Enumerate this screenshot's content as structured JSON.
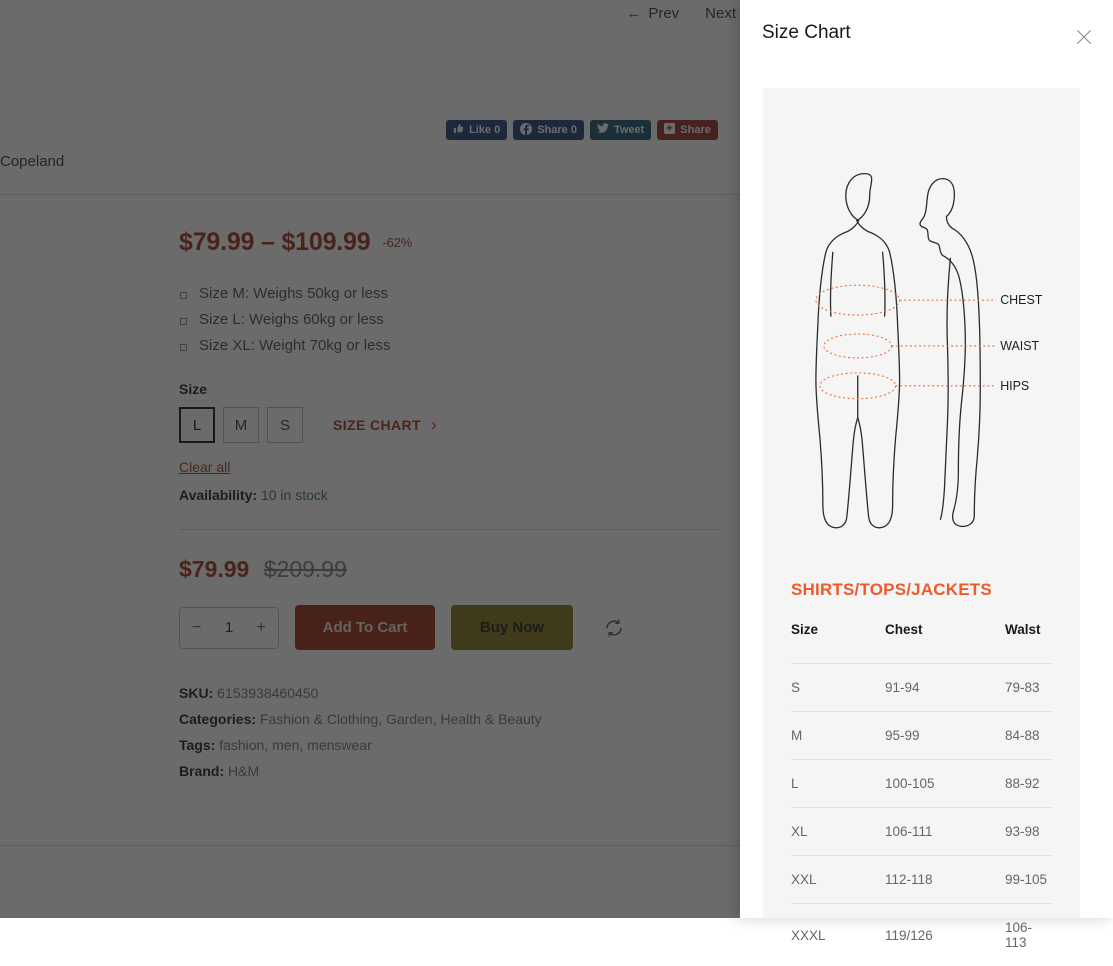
{
  "product_page": {
    "nav": {
      "prev_label": "Prev",
      "next_label": "Next",
      "prev_arrow": "←",
      "next_arrow": "→"
    },
    "breadcrumb": "Copeland",
    "social_buttons": [
      {
        "name": "facebook-like",
        "icon": "thumbs-up-icon",
        "glyph": "👍",
        "label": "Like 0",
        "color": "#1b3d7a"
      },
      {
        "name": "facebook-share",
        "icon": "facebook-icon",
        "glyph": "f",
        "label": "Share 0",
        "color": "#1b3d7a"
      },
      {
        "name": "twitter-tweet",
        "icon": "twitter-bird-icon",
        "glyph": "🐦",
        "label": "Tweet",
        "color": "#14506b"
      },
      {
        "name": "pinterest-share",
        "icon": "plus-box-icon",
        "glyph": "✚",
        "label": "Share",
        "color": "#8f2b24"
      }
    ],
    "price_range": "$79.99 – $109.99",
    "discount_badge": "-62%",
    "bullets": [
      "Size M: Weighs 50kg or less",
      "Size L: Weighs 60kg or less",
      "Size XL: Weight 70kg or less"
    ],
    "size_label": "Size",
    "sizes": [
      {
        "label": "L",
        "selected": true
      },
      {
        "label": "M",
        "selected": false
      },
      {
        "label": "S",
        "selected": false
      }
    ],
    "size_chart_link": "SIZE CHART",
    "clear_all": "Clear all",
    "availability_label": "Availability:",
    "availability_value": "10 in stock",
    "price_current": "$79.99",
    "price_old": "$209.99",
    "quantity": "1",
    "minus_label": "−",
    "plus_label": "+",
    "add_to_cart": "Add To Cart",
    "buy_now": "Buy Now",
    "meta": {
      "sku_label": "SKU:",
      "sku_value": "6153938460450",
      "categories_label": "Categories:",
      "categories": [
        "Fashion & Clothing",
        "Garden",
        "Health & Beauty"
      ],
      "tags_label": "Tags:",
      "tags": [
        "fashion",
        "men",
        "menswear"
      ],
      "brand_label": "Brand:",
      "brand_value": "H&M"
    }
  },
  "size_chart_modal": {
    "title": "Size Chart",
    "close_icon": "×",
    "diagram": {
      "labels": [
        "CHEST",
        "WAIST",
        "HIPS"
      ],
      "line_color": "#e8703a"
    },
    "heading": "SHIRTS/TOPS/JACKETS",
    "heading_color": "#ef5a28",
    "table": {
      "columns": [
        "Size",
        "Chest",
        "Walst"
      ],
      "rows": [
        [
          "S",
          "91-94",
          "79-83"
        ],
        [
          "M",
          "95-99",
          "84-88"
        ],
        [
          "L",
          "100-105",
          "88-92"
        ],
        [
          "XL",
          "106-111",
          "93-98"
        ],
        [
          "XXL",
          "112-118",
          "99-105"
        ],
        [
          "XXXL",
          "119/126",
          "106-113"
        ]
      ]
    }
  }
}
